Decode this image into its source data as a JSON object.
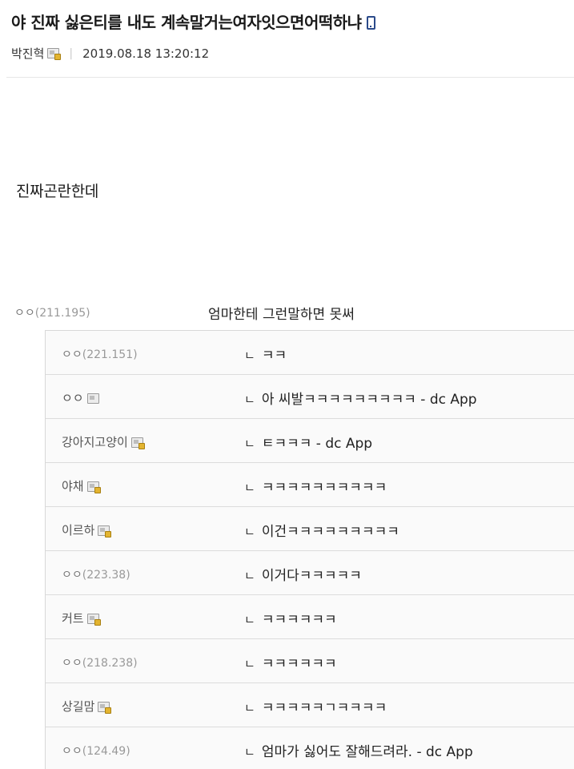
{
  "post": {
    "title": "야 진짜 싫은티를 내도 계속말거는여자잇으면어떡하냐",
    "author": "박진혁",
    "datetime": "2019.08.18 13:20:12",
    "separator": "|",
    "body": "진짜곤란한데"
  },
  "comment": {
    "nick": "ㅇㅇ",
    "ip": "(211.195)",
    "text": "엄마한테 그런말하면 못써"
  },
  "reply_mark": "ㄴ",
  "replies": [
    {
      "nick": "ㅇㅇ",
      "ip": "(221.151)",
      "text": "ㅋㅋ"
    },
    {
      "nick": "ㅇㅇ",
      "ip": "",
      "text": "아 씨발ㅋㅋㅋㅋㅋㅋㅋㅋㅋ - dc App"
    },
    {
      "nick": "강아지고양이",
      "ip": "",
      "text": "ㅌㅋㅋㅋ - dc App"
    },
    {
      "nick": "야채",
      "ip": "",
      "text": "ㅋㅋㅋㅋㅋㅋㅋㅋㅋㅋ"
    },
    {
      "nick": "이르하",
      "ip": "",
      "text": "이건ㅋㅋㅋㅋㅋㅋㅋㅋㅋ"
    },
    {
      "nick": "ㅇㅇ",
      "ip": "(223.38)",
      "text": "이거다ㅋㅋㅋㅋㅋ"
    },
    {
      "nick": "커트",
      "ip": "",
      "text": "ㅋㅋㅋㅋㅋㅋ"
    },
    {
      "nick": "ㅇㅇ",
      "ip": "(218.238)",
      "text": "ㅋㅋㅋㅋㅋㅋ"
    },
    {
      "nick": "상길맘",
      "ip": "",
      "text": "ㅋㅋㅋㅋㅋㄱㅋㅋㅋㅋ"
    },
    {
      "nick": "ㅇㅇ",
      "ip": "(124.49)",
      "text": "엄마가 싫어도 잘해드려라. - dc App"
    }
  ],
  "icons": {
    "title_device": "mobile-phone-icon",
    "gallog": "gallog-icon",
    "accent": "#2b4a8a"
  }
}
